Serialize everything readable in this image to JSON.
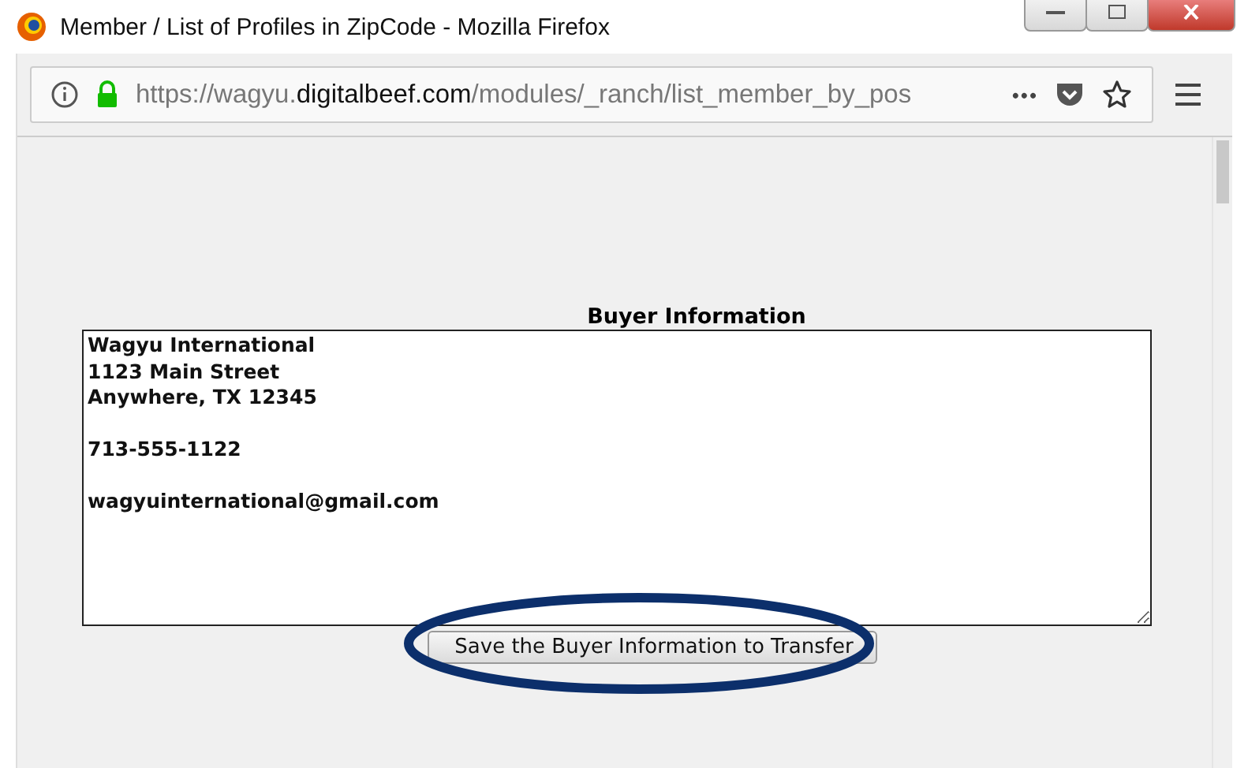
{
  "window": {
    "title": "Member / List of Profiles in ZipCode - Mozilla Firefox"
  },
  "address_bar": {
    "url_prefix": "https://wagyu.",
    "url_domain": "digitalbeef.com",
    "url_path": "/modules/_ranch/list_member_by_pos",
    "more": "•••"
  },
  "form": {
    "heading": "Buyer Information",
    "value": "Wagyu International\n1123 Main Street\nAnywhere, TX 12345\n\n713-555-1122\n\nwagyuinternational@gmail.com",
    "button": "Save the Buyer Information to Transfer",
    "button_circled": true
  }
}
